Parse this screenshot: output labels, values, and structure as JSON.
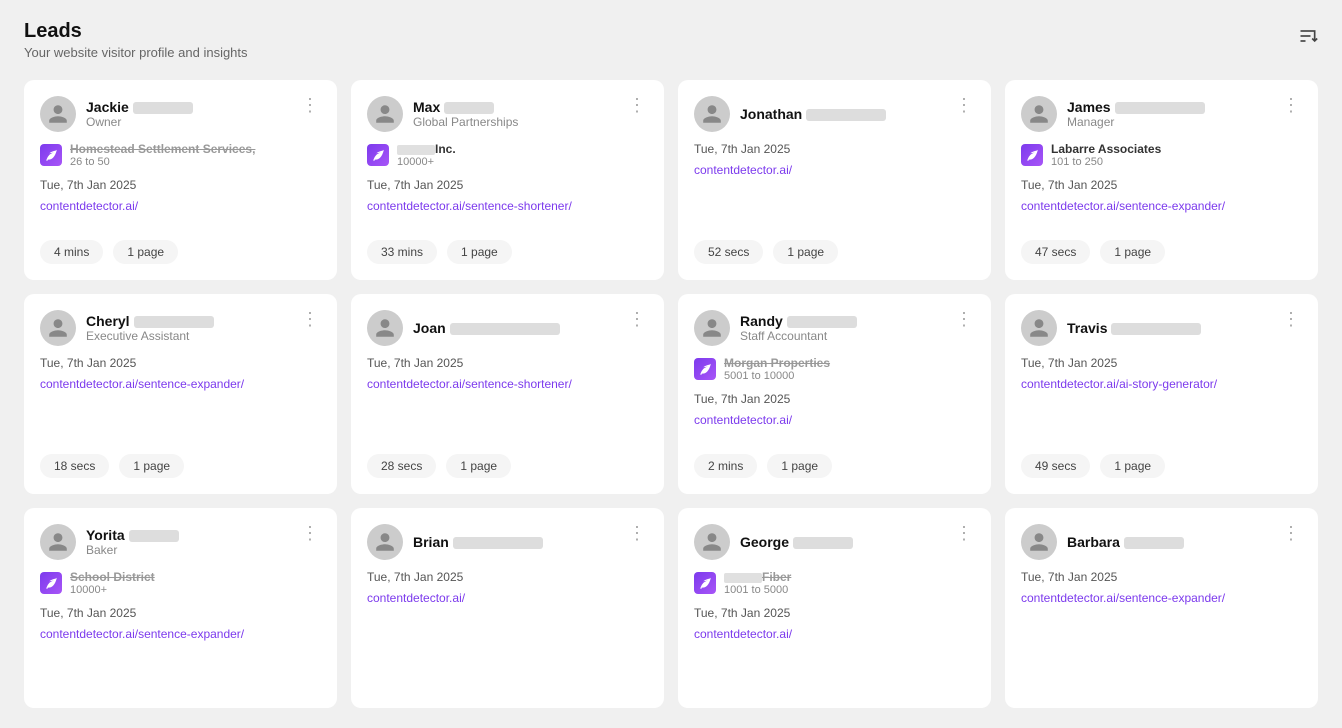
{
  "header": {
    "title": "Leads",
    "subtitle": "Your website visitor profile and insights",
    "sort_icon": "⇅"
  },
  "cards": [
    {
      "id": "card-1",
      "name": "Jackie",
      "name_blur_width": 60,
      "role": "Owner",
      "company_name": "Homestead Settlement Services,",
      "company_name_strikethrough": true,
      "company_size": "26 to 50",
      "date": "Tue, 7th Jan 2025",
      "link": "contentdetector.ai/",
      "time_stat": "4 mins",
      "page_stat": "1 page"
    },
    {
      "id": "card-2",
      "name": "Max",
      "name_blur_width": 50,
      "role": "Global Partnerships",
      "company_name": "S",
      "company_name_blur": true,
      "company_suffix": " Inc.",
      "company_size": "10000+",
      "date": "Tue, 7th Jan 2025",
      "link": "contentdetector.ai/sentence-shortener/",
      "time_stat": "33 mins",
      "page_stat": "1 page"
    },
    {
      "id": "card-3",
      "name": "Jonathan",
      "name_blur_width": 80,
      "role": "",
      "company_name": "",
      "company_size": "",
      "date": "Tue, 7th Jan 2025",
      "link": "contentdetector.ai/",
      "time_stat": "52 secs",
      "page_stat": "1 page"
    },
    {
      "id": "card-4",
      "name": "James",
      "name_blur_width": 90,
      "role": "Manager",
      "company_name": "Labarre Associates",
      "company_name_strikethrough": false,
      "company_size": "101 to 250",
      "date": "Tue, 7th Jan 2025",
      "link": "contentdetector.ai/sentence-expander/",
      "time_stat": "47 secs",
      "page_stat": "1 page"
    },
    {
      "id": "card-5",
      "name": "Cheryl",
      "name_blur_width": 80,
      "role": "Executive Assistant",
      "company_name": "",
      "company_size": "",
      "date": "Tue, 7th Jan 2025",
      "link": "contentdetector.ai/sentence-expander/",
      "time_stat": "18 secs",
      "page_stat": "1 page"
    },
    {
      "id": "card-6",
      "name": "Joan",
      "name_blur_width": 110,
      "role": "",
      "company_name": "",
      "company_size": "",
      "date": "Tue, 7th Jan 2025",
      "link": "contentdetector.ai/sentence-shortener/",
      "time_stat": "28 secs",
      "page_stat": "1 page"
    },
    {
      "id": "card-7",
      "name": "Randy",
      "name_blur_width": 70,
      "role": "Staff Accountant",
      "company_name": "Morgan Properties",
      "company_name_strikethrough": true,
      "company_size": "5001 to 10000",
      "date": "Tue, 7th Jan 2025",
      "link": "contentdetector.ai/",
      "time_stat": "2 mins",
      "page_stat": "1 page"
    },
    {
      "id": "card-8",
      "name": "Travis",
      "name_blur_width": 90,
      "role": "",
      "company_name": "",
      "company_size": "",
      "date": "Tue, 7th Jan 2025",
      "link": "contentdetector.ai/ai-story-generator/",
      "time_stat": "49 secs",
      "page_stat": "1 page"
    },
    {
      "id": "card-9",
      "name": "Yorita",
      "name_blur_width": 50,
      "role": "Baker",
      "company_name": "School District",
      "company_name_strikethrough": true,
      "company_size": "10000+",
      "date": "Tue, 7th Jan 2025",
      "link": "contentdetector.ai/sentence-expander/",
      "time_stat": "",
      "page_stat": ""
    },
    {
      "id": "card-10",
      "name": "Brian",
      "name_blur_width": 90,
      "role": "",
      "company_name": "",
      "company_size": "",
      "date": "Tue, 7th Jan 2025",
      "link": "contentdetector.ai/",
      "time_stat": "",
      "page_stat": ""
    },
    {
      "id": "card-11",
      "name": "George",
      "name_blur_width": 60,
      "role": "",
      "company_name": "Fiber",
      "company_name_strikethrough": true,
      "company_size": "1001 to 5000",
      "date": "Tue, 7th Jan 2025",
      "link": "contentdetector.ai/",
      "time_stat": "",
      "page_stat": ""
    },
    {
      "id": "card-12",
      "name": "Barbara",
      "name_blur_width": 60,
      "role": "",
      "company_name": "",
      "company_size": "",
      "date": "Tue, 7th Jan 2025",
      "link": "contentdetector.ai/sentence-expander/",
      "time_stat": "",
      "page_stat": ""
    }
  ]
}
